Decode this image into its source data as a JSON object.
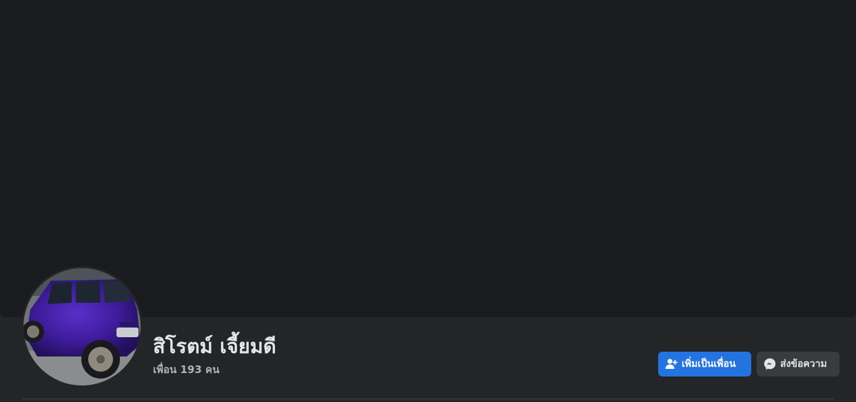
{
  "profile": {
    "name": "สิโรตม์ เจี้ยมดี",
    "friends_count": "เพื่อน 193 คน"
  },
  "actions": {
    "add_friend_label": "เพิ่มเป็นเพื่อน",
    "message_label": "ส่งข้อความ"
  },
  "icons": {
    "add_friend": "person-plus-icon",
    "message": "messenger-icon"
  },
  "colors": {
    "primary_button": "#2374e1",
    "secondary_button": "#3a3b3c",
    "cover_background": "#1a1b1e",
    "page_background": "#242526"
  }
}
